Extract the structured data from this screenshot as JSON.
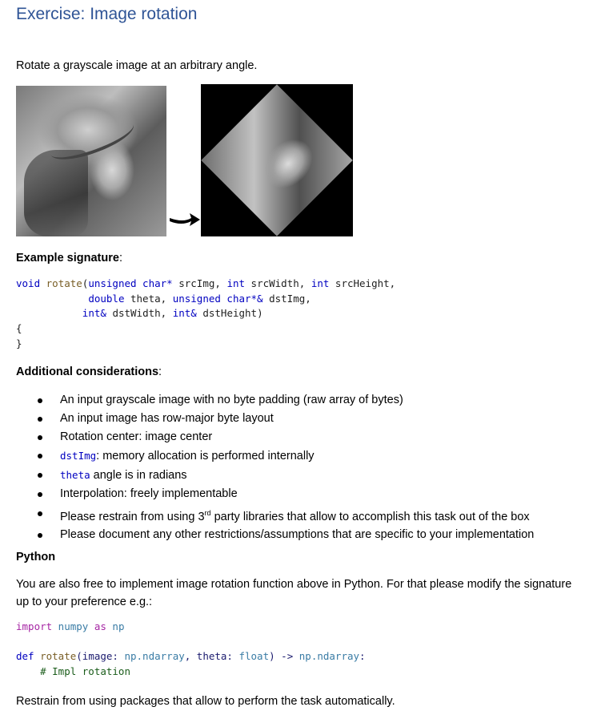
{
  "title": "Exercise: Image rotation",
  "intro": "Rotate a grayscale image at an arbitrary angle.",
  "images": {
    "original": "lena-grayscale-icon",
    "arrow": "arrow-right-icon",
    "rotated": "lena-rotated-icon"
  },
  "example_signature": {
    "heading": "Example signature",
    "colon": ":",
    "cpp": {
      "l1_void": "void ",
      "l1_fn": "rotate",
      "l1_open": "(",
      "l1_t1": "unsigned char* ",
      "l1_a1": "srcImg, ",
      "l1_t2": "int ",
      "l1_a2": "srcWidth, ",
      "l1_t3": "int ",
      "l1_a3": "srcHeight,",
      "l2_indent": "            ",
      "l2_t1": "double ",
      "l2_a1": "theta, ",
      "l2_t2": "unsigned char*& ",
      "l2_a2": "dstImg,",
      "l3_indent": "           ",
      "l3_t1": "int& ",
      "l3_a1": "dstWidth, ",
      "l3_t2": "int& ",
      "l3_a2": "dstHeight)",
      "l4": "{",
      "l5": "}"
    }
  },
  "additional": {
    "heading": "Additional considerations",
    "colon": ":",
    "items": [
      "An input grayscale image with no byte padding (raw array of bytes)",
      "An input image has row-major byte layout",
      "Rotation center: image center",
      {
        "code": "dstImg",
        "text": ": memory allocation is performed internally"
      },
      {
        "code": "theta",
        "text": " angle is in radians"
      },
      "Interpolation: freely implementable",
      {
        "pre": "Please restrain from using 3",
        "sup": "rd",
        "post": " party libraries that allow to accomplish this task out of the box"
      },
      "Please document any other restrictions/assumptions that are specific to your implementation"
    ]
  },
  "python": {
    "heading": "Python",
    "text": "You are also free to implement image rotation function above in Python. For that please modify the signature up to your preference e.g.:",
    "code": {
      "import_kw": "import",
      "numpy": " numpy ",
      "as_kw": "as",
      "np": " np",
      "def_kw": "def",
      "fn": " rotate",
      "p1": "(image: ",
      "t1": "np.ndarray",
      "p2": ", theta: ",
      "t2": "float",
      "p3": ") -> ",
      "t3": "np.ndarray",
      "p4": ":",
      "comment": "    # Impl rotation"
    },
    "closing": "Restrain from using packages that allow to perform the task automatically."
  }
}
